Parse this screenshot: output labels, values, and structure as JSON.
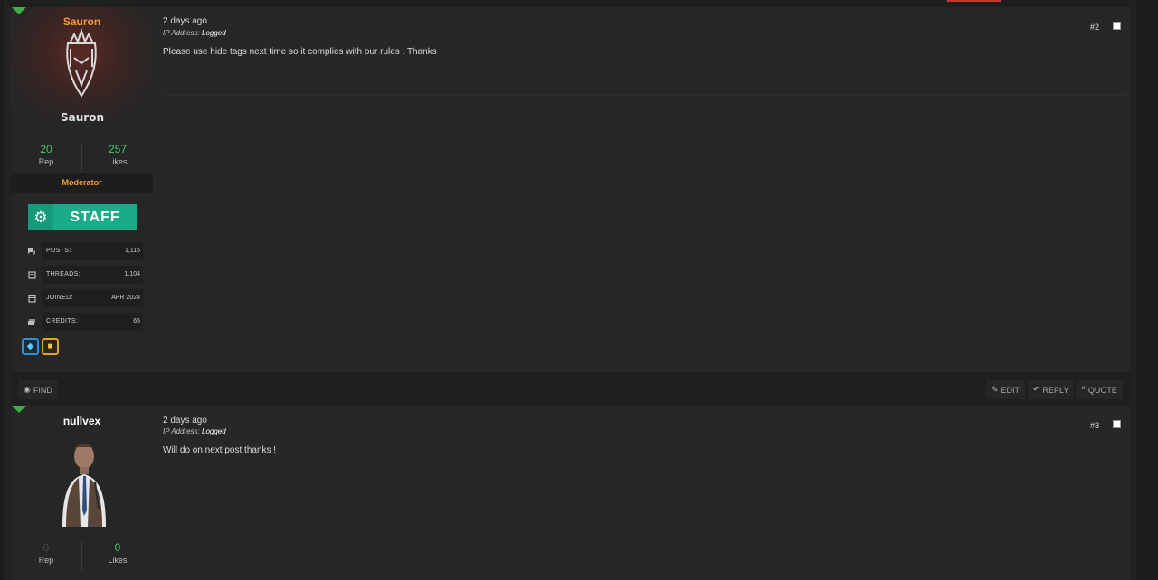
{
  "posts": [
    {
      "username": "Sauron",
      "avatar_icon": "sauron-helmet-avatar",
      "avatar_text": "Sauron",
      "rep": "20",
      "rep_label": "Rep",
      "likes": "257",
      "likes_label": "Likes",
      "role": "Moderator",
      "staff_badge": "STAFF",
      "info": [
        {
          "icon": "comments-icon",
          "key": "POSTS:",
          "value": "1,115"
        },
        {
          "icon": "book-icon",
          "key": "THREADS:",
          "value": "1,104"
        },
        {
          "icon": "calendar-icon",
          "key": "JOINED:",
          "value": "APR 2024"
        },
        {
          "icon": "money-icon",
          "key": "CREDITS:",
          "value": "65"
        }
      ],
      "awards": [
        "diamond-award-icon",
        "gold-award-icon"
      ],
      "date": "2 days ago",
      "ip_label": "IP Address:",
      "ip_value": "Logged",
      "post_number": "#2",
      "message": "Please use hide tags next time so it complies with our rules . Thanks",
      "actions": {
        "find": "FIND",
        "edit": "EDIT",
        "reply": "REPLY",
        "quote": "QUOTE"
      }
    },
    {
      "username": "nullvex",
      "avatar_icon": "character-avatar",
      "rep": "0",
      "rep_label": "Rep",
      "likes": "0",
      "likes_label": "Likes",
      "date": "2 days ago",
      "ip_label": "IP Address:",
      "ip_value": "Logged",
      "post_number": "#3",
      "message": "Will do on next post thanks !"
    }
  ],
  "colors": {
    "accent_orange": "#f39c32",
    "online_green": "#3fae49",
    "stat_green": "#46c96b",
    "staff_teal": "#1aab8a"
  }
}
